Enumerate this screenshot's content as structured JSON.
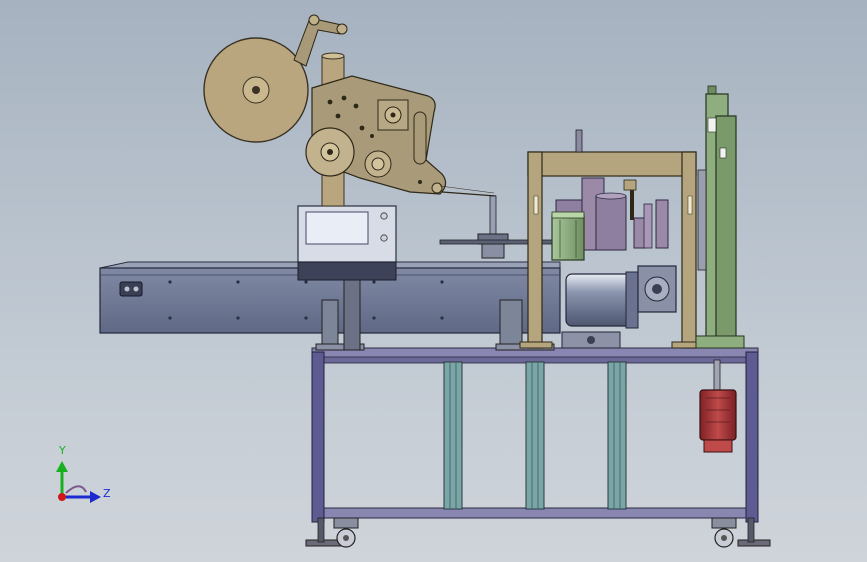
{
  "triad": {
    "y_label": "Y",
    "z_label": "Z",
    "y_color": "#18b020",
    "z_color": "#1c2ad0",
    "origin_color": "#d01818"
  },
  "colors": {
    "label_reel": "#b9a67e",
    "label_plate": "#a89a78",
    "frame_gold": "#b5a57e",
    "green_column": "#8fae7f",
    "purple_part": "#9a8aa8",
    "conveyor": "#6c7692",
    "motor_red": "#a8383a",
    "table_frame": "#6e6a9c",
    "leg_teal": "#6f9a9c"
  }
}
